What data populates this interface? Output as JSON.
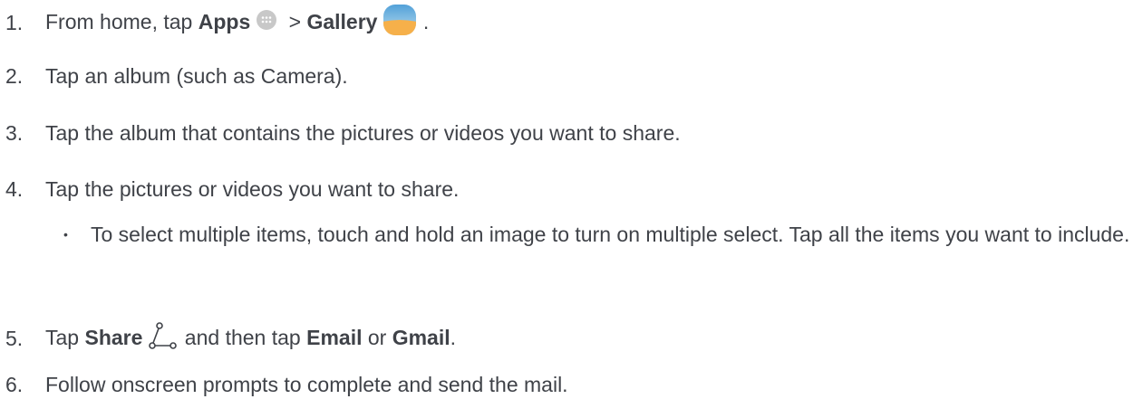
{
  "steps": [
    {
      "num": "1.",
      "parts": [
        "From home, tap ",
        "Apps",
        " > ",
        "Gallery",
        " ."
      ]
    },
    {
      "num": "2.",
      "text": "Tap an album (such as Camera)."
    },
    {
      "num": "3.",
      "text": "Tap the album that contains the pictures or videos you want to share."
    },
    {
      "num": "4.",
      "text": "Tap the pictures or videos you want to share."
    },
    {
      "num": "5.",
      "parts": [
        "Tap ",
        "Share",
        " and then tap ",
        "Email",
        " or ",
        "Gmail",
        "."
      ]
    },
    {
      "num": "6.",
      "text": "Follow onscreen prompts to complete and send the mail."
    }
  ],
  "sub_bullet": {
    "bullet": "•",
    "text": "To select multiple items, touch and hold an image to turn on multiple select. Tap all the items you want to include."
  },
  "icons": {
    "apps": "apps-icon",
    "gallery": "gallery-icon",
    "share": "share-icon"
  },
  "colors": {
    "text": "#3f4248",
    "apps_icon": "#c8c8c8",
    "gallery_top": "#56a8dd",
    "gallery_bottom": "#f6b04a"
  }
}
